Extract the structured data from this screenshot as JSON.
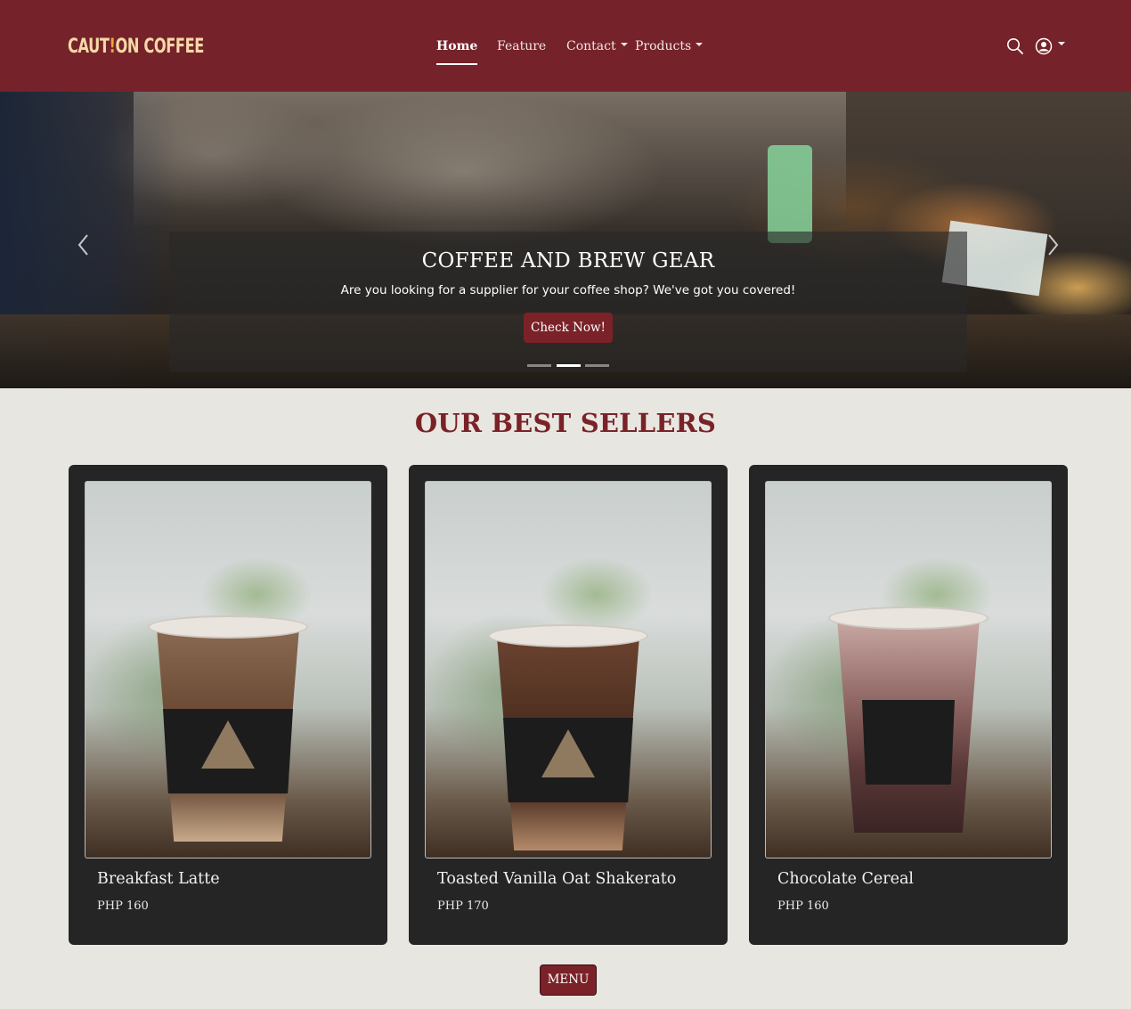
{
  "brand": {
    "logo_left": "CAUT",
    "logo_bang": "!",
    "logo_right": "ON COFFEE"
  },
  "nav": {
    "items": [
      {
        "label": "Home",
        "active": true
      },
      {
        "label": "Feature",
        "active": false
      },
      {
        "label": "Contact",
        "dropdown": true
      },
      {
        "label": "Products",
        "dropdown": true
      }
    ],
    "icons": [
      "search-icon",
      "user-circle-icon"
    ]
  },
  "hero": {
    "title": "COFFEE AND BREW GEAR",
    "subtitle": "Are you looking for a supplier for your coffee shop? We've got you covered!",
    "button_label": "Check Now!",
    "slide_count": 3,
    "active_slide": 2
  },
  "best_sellers": {
    "title": "OUR BEST SELLERS",
    "products": [
      {
        "name": "Breakfast Latte",
        "price": "PHP 160"
      },
      {
        "name": "Toasted Vanilla Oat Shakerato",
        "price": "PHP 170"
      },
      {
        "name": "Chocolate Cereal",
        "price": "PHP 160"
      }
    ],
    "menu_label": "MENU"
  },
  "colors": {
    "brand": "#75222a",
    "accent": "#7a2228",
    "background": "#e8e6e0",
    "card": "#252526",
    "logo": "#f6d9a8"
  }
}
